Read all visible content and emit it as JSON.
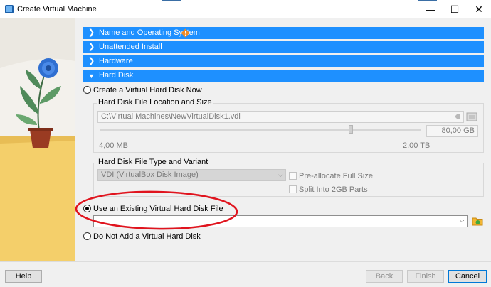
{
  "window": {
    "title": "Create Virtual Machine",
    "controls": {
      "minimize": "—",
      "maximize": "☐",
      "close": "✕"
    }
  },
  "sections": [
    {
      "label": "Name and Operating System",
      "icon": "warning-icon"
    },
    {
      "label": "Unattended Install"
    },
    {
      "label": "Hardware"
    },
    {
      "label": "Hard Disk",
      "expanded": true
    }
  ],
  "hard_disk": {
    "option_create": "Create a Virtual Hard Disk Now",
    "location_group": {
      "title": "Hard Disk File Location and Size",
      "path": "C:\\Virtual Machines\\NewVirtualDisk1.vdi",
      "size_value": "80,00 GB",
      "size_min": "4,00 MB",
      "size_max": "2,00 TB",
      "size_fraction": 0.78
    },
    "type_group": {
      "title": "Hard Disk File Type and Variant",
      "type_value": "VDI (VirtualBox Disk Image)",
      "preallocate": "Pre-allocate Full Size",
      "split": "Split Into 2GB Parts"
    },
    "option_existing": "Use an Existing Virtual Hard Disk File",
    "existing_value": "",
    "option_none": "Do Not Add a Virtual Hard Disk",
    "selected": "existing"
  },
  "buttons": {
    "help": "Help",
    "back": "Back",
    "finish": "Finish",
    "cancel": "Cancel"
  },
  "colors": {
    "section_header": "#1e90ff",
    "highlight_ellipse": "#e0141e"
  }
}
